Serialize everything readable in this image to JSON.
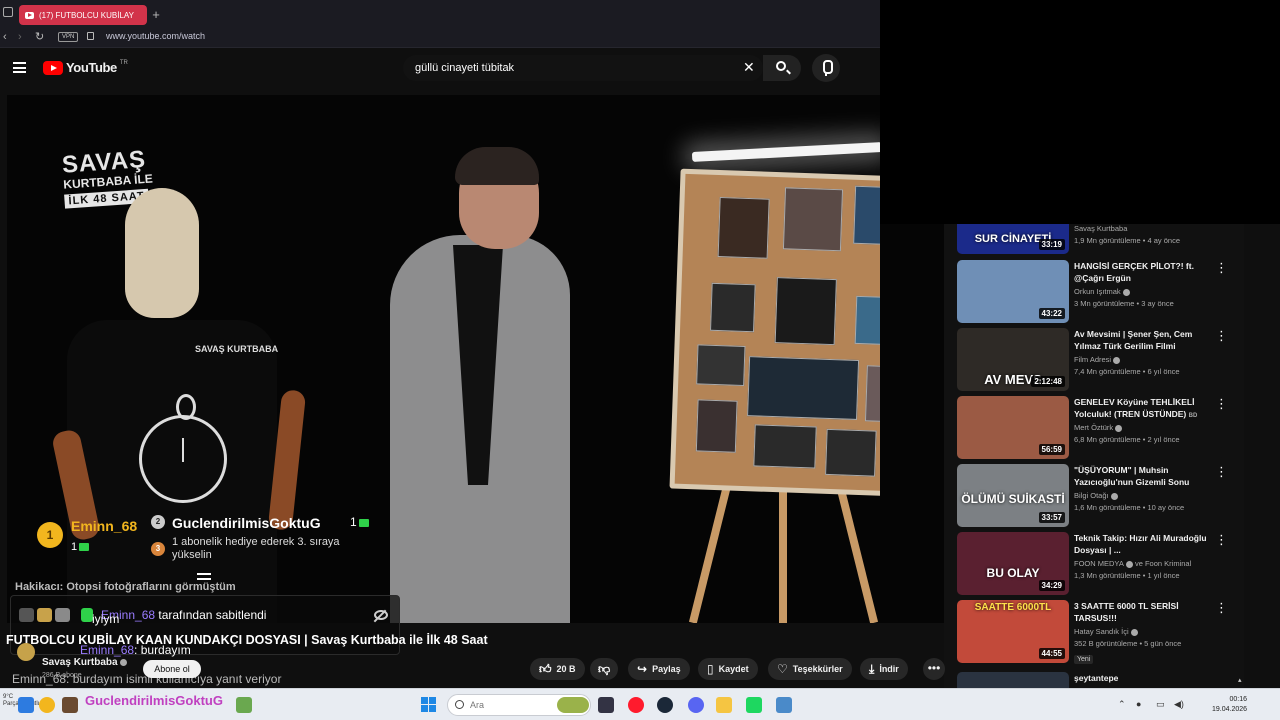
{
  "browser": {
    "tab_title": "(17) FUTBOLCU KUBİLAY",
    "new_tab": "+",
    "vpn_label": "VPN",
    "url": "www.youtube.com/watch"
  },
  "masthead": {
    "logo_text": "YouTube",
    "country_code": "TR",
    "search_value": "güllü cinayeti tübitak",
    "clear": "✕"
  },
  "video_scene": {
    "logo_line1": "SAVAŞ",
    "logo_line2": "KURTBABA İLE",
    "logo_line3": "İLK 48 SAAT",
    "shirt_brand": "SAVAŞ KURTBABA"
  },
  "overlay": {
    "top1": {
      "rank": "1",
      "name": "Eminn_68",
      "count": "1"
    },
    "top2": {
      "rank": "2",
      "name": "GuclendirilmisGoktuG",
      "count": "1"
    },
    "top3": {
      "rank": "3",
      "count": "1",
      "text": "1 abonelik hediye ederek 3. sıraya yükselin"
    },
    "ticker": "Hakikacı: Otopsi fotoğraflarını görmüştüm",
    "pinned_user": "Eminn_68",
    "pinned_suffix": " tarafından sabitlendi",
    "chat_line1": "iyiym",
    "chat_line2_user": "Eminn_68",
    "chat_line2_text": ": burdayım",
    "chat_reply": "Eminn_68: burdayım isimli kullanıcıya yanıt veriyor"
  },
  "video": {
    "title": "FUTBOLCU KUBİLAY KAAN KUNDAKÇI DOSYASI | Savaş Kurtbaba ile İlk 48 Saat",
    "channel": "Savaş Kurtbaba",
    "subscribers": "286 B abone",
    "subscribe_label": "Abone ol",
    "actions": {
      "likes": "20 B",
      "share": "Paylaş",
      "save": "Kaydet",
      "thanks": "Teşekkürler",
      "download": "İndir"
    }
  },
  "recommendations": [
    {
      "title": "",
      "channel": "Savaş Kurtbaba",
      "views": "1,9 Mn görüntüleme • 4 ay önce",
      "duration": "33:19",
      "caption": "SUR CİNAYETİ",
      "color": "#1b2a8a"
    },
    {
      "title": "HANGİSİ GERÇEK PİLOT?! ft. @Çağrı Ergün",
      "channel": "Orkun Işıtmak",
      "views": "3 Mn görüntüleme • 3 ay önce",
      "duration": "43:22",
      "caption": "",
      "color": "#6f8fb6"
    },
    {
      "title": "Av Mevsimi | Şener Şen, Cem Yılmaz Türk Gerilim Filmi",
      "channel": "Film Adresi",
      "views": "7,4 Mn görüntüleme • 6 yıl önce",
      "duration": "2:12:48",
      "caption": "AV MEVS",
      "color": "#2e2a26"
    },
    {
      "title": "GENELEV Köyüne TEHLİKELİ Yolculuk! (TREN ÜSTÜNDE)",
      "channel": "Mert Öztürk",
      "views": "6,8 Mn görüntüleme • 2 yıl önce",
      "duration": "56:59",
      "caption": "",
      "color": "#9b5a44",
      "badge": "BD"
    },
    {
      "title": "\"ÜŞÜYORUM\" | Muhsin Yazıcıoğlu'nun Gizemli Sonu",
      "channel": "Bilgi Otağı",
      "views": "1,6 Mn görüntüleme • 10 ay önce",
      "duration": "33:57",
      "caption": "ÖLÜMÜ SUİKASTİ",
      "color": "#7c8084"
    },
    {
      "title": "Teknik Takip: Hızır Ali Muradoğlu Dosyası | ...",
      "channel": "FOON MEDYA",
      "channel_extra": "ve Foon Kriminal",
      "views": "1,3 Mn görüntüleme • 1 yıl önce",
      "duration": "34:29",
      "caption": "BU OLAY",
      "color": "#5a2030"
    },
    {
      "title": "3 SAATTE 6000 TL SERİSİ TARSUS!!!",
      "channel": "Hatay Sandık İçi",
      "views": "352 B görüntüleme • 5 gün önce",
      "duration": "44:55",
      "caption": "SAATTE 6000TL",
      "color": "#c24a3a",
      "new": "Yeni"
    },
    {
      "title": "şeytantepe",
      "channel": "",
      "views": "",
      "duration": "",
      "caption": "",
      "color": "#2a3340"
    }
  ],
  "taskbar": {
    "weather_temp": "9°C",
    "weather_desc": "Parçalı bulutlu",
    "overlay_username": "GuclendirilmisGoktuG",
    "search_placeholder": "Ara",
    "time": "00:16",
    "date": "19.04.2026"
  }
}
